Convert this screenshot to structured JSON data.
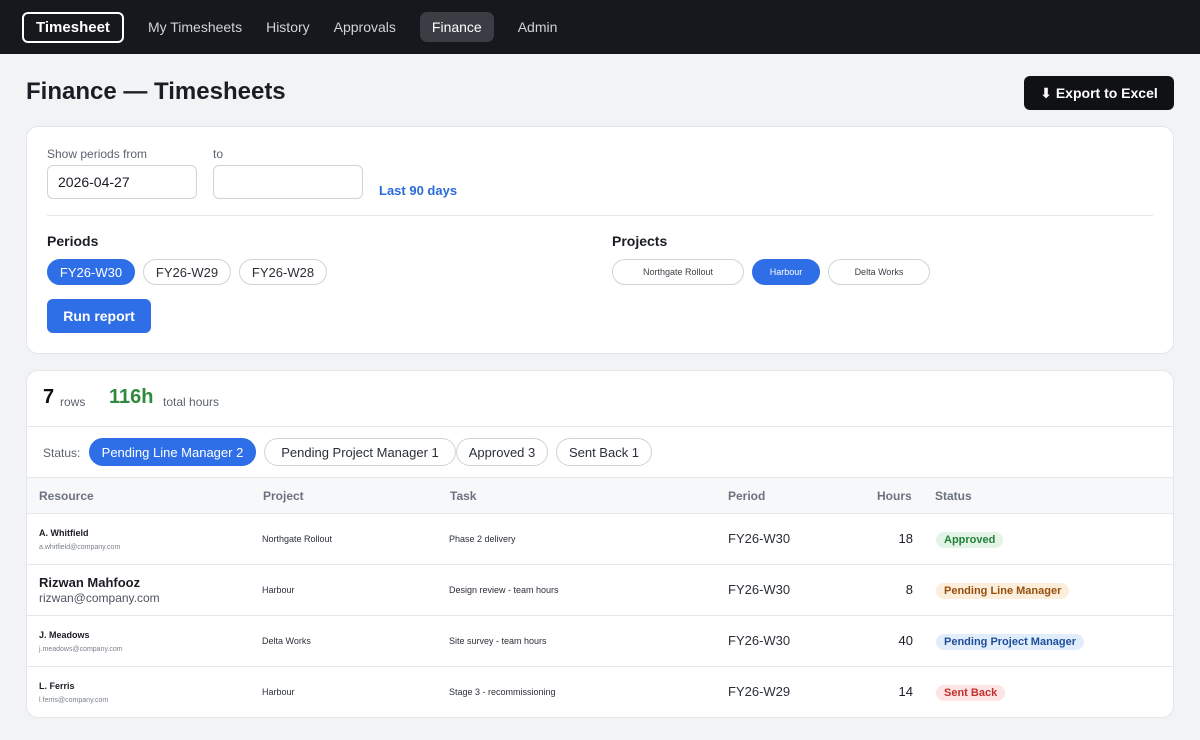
{
  "nav": {
    "brand": "Timesheet",
    "links": [
      "My Timesheets",
      "History",
      "Approvals",
      "Finance",
      "Admin"
    ],
    "active": "Finance"
  },
  "header": {
    "title": "Finance — Timesheets",
    "export_label": "⬇ Export to Excel"
  },
  "filters": {
    "from_label": "Show periods from",
    "from_value": "2026-04-27",
    "to_label": "to",
    "to_value": "",
    "quick_range": "Last 90 days",
    "periods_heading": "Periods",
    "periods": [
      {
        "label": "FY26-W30",
        "selected": true
      },
      {
        "label": "FY26-W29",
        "selected": false
      },
      {
        "label": "FY26-W28",
        "selected": false
      }
    ],
    "projects_heading": "Projects",
    "projects": [
      {
        "label": "Northgate Rollout",
        "selected": false
      },
      {
        "label": "Harbour",
        "selected": true
      },
      {
        "label": "Delta Works",
        "selected": false
      }
    ],
    "run_label": "Run report"
  },
  "summary": {
    "rows_count": "7",
    "rows_label": "rows",
    "hours_total": "116h",
    "hours_label": "total hours",
    "hours_color": "#2f8a3e"
  },
  "status_filter": {
    "label": "Status:",
    "chips": [
      {
        "label": "Pending Line Manager 2",
        "selected": true
      },
      {
        "label": "Pending Project Manager 1",
        "selected": false
      },
      {
        "label": "Approved 3",
        "selected": false
      },
      {
        "label": "Sent Back 1",
        "selected": false
      }
    ]
  },
  "table": {
    "headers": [
      "Resource",
      "Project",
      "Task",
      "Period",
      "Hours",
      "Status"
    ],
    "rows": [
      {
        "name": "A. Whitfield",
        "email": "a.whitfield@company.com",
        "project": "Northgate Rollout",
        "task": "Phase 2 delivery",
        "period": "FY26-W30",
        "hours": "18",
        "status": "Approved"
      },
      {
        "name": "Rizwan Mahfooz",
        "email": "rizwan@company.com",
        "project": "Harbour",
        "task": "Design review - team hours",
        "period": "FY26-W30",
        "hours": "8",
        "status": "Pending Line Manager"
      },
      {
        "name": "J. Meadows",
        "email": "j.meadows@company.com",
        "project": "Delta Works",
        "task": "Site survey - team hours",
        "period": "FY26-W30",
        "hours": "40",
        "status": "Pending Project Manager"
      },
      {
        "name": "L. Ferris",
        "email": "l.ferris@company.com",
        "project": "Harbour",
        "task": "Stage 3 - recommissioning",
        "period": "FY26-W29",
        "hours": "14",
        "status": "Sent Back"
      }
    ]
  },
  "colors": {
    "accent": "#2e6ee6",
    "nav_bg": "#16181d"
  }
}
